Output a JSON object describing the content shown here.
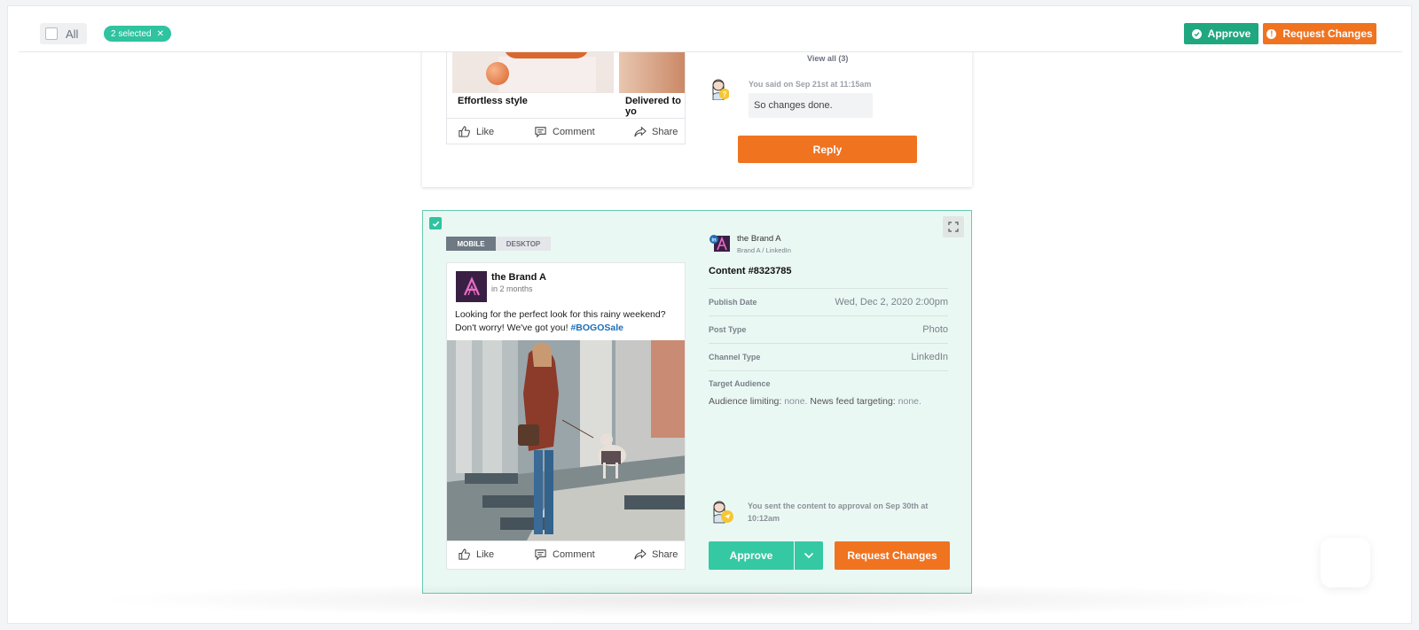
{
  "toolbar": {
    "all_label": "All",
    "selected_chip": "2 selected",
    "approve_label": "Approve",
    "request_changes_label": "Request Changes"
  },
  "card1": {
    "carousel": {
      "captions": [
        "Effortless style",
        "Delivered to yo"
      ]
    },
    "actions": {
      "like": "Like",
      "comment": "Comment",
      "share": "Share"
    },
    "view_all": "View all (3)",
    "comment_meta": "You said on Sep 21st at 11:15am",
    "comment_text": "So changes done.",
    "reply_label": "Reply"
  },
  "card2": {
    "view_tabs": [
      "MOBILE",
      "DESKTOP"
    ],
    "post": {
      "brand_name": "the Brand A",
      "time": "in 2 months",
      "text_line1": "Looking for the perfect look for this rainy weekend?",
      "text_line2": "Don't worry! We've got you! ",
      "hashtag": "#BOGOSale",
      "actions": {
        "like": "Like",
        "comment": "Comment",
        "share": "Share"
      }
    },
    "details": {
      "brand": "the Brand A",
      "channel": "Brand A / LinkedIn",
      "content_id": "Content #8323785",
      "rows": [
        {
          "key": "Publish Date",
          "value": "Wed, Dec 2, 2020 2:00pm"
        },
        {
          "key": "Post Type",
          "value": "Photo"
        },
        {
          "key": "Channel Type",
          "value": "LinkedIn"
        }
      ],
      "audience_label": "Target Audience",
      "audience_limiting": "Audience limiting:",
      "audience_limiting_value": "none.",
      "news_feed": "News feed targeting:",
      "news_feed_value": "none."
    },
    "sent_text": "You sent the content to approval on Sep 30th at 10:12am",
    "approve_label": "Approve",
    "request_changes_label": "Request Changes"
  },
  "colors": {
    "teal": "#2fc3a0",
    "approve_green": "#1fa780",
    "orange": "#f07320",
    "selected_bg": "#eaf8f4"
  }
}
